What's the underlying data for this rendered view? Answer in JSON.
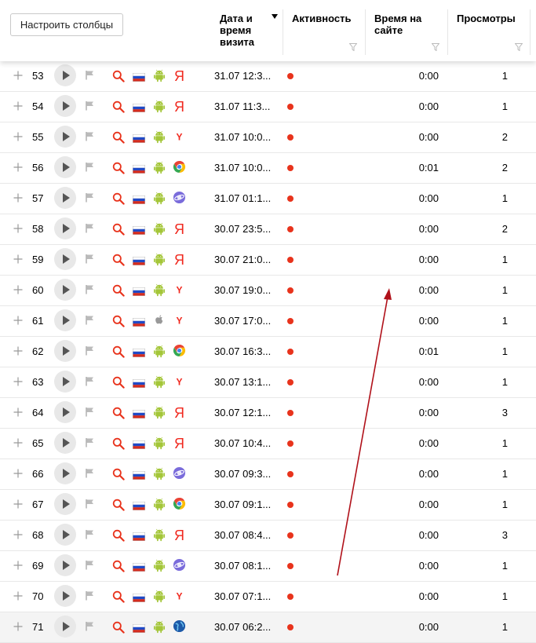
{
  "toolbar": {
    "configure_columns_label": "Настроить столбцы"
  },
  "columns": {
    "date_line1": "Дата и",
    "date_line2": "время",
    "date_line3": "визита",
    "activity": "Активность",
    "time_line1": "Время на",
    "time_line2": "сайте",
    "views": "Просмотры"
  },
  "colors": {
    "activity_dot": "#e8331c",
    "arrow": "#b0111a"
  },
  "rows": [
    {
      "num": "53",
      "os": "android",
      "browser": "yandex",
      "date": "31.07 12:3...",
      "time": "0:00",
      "views": "1"
    },
    {
      "num": "54",
      "os": "android",
      "browser": "yandex",
      "date": "31.07 11:3...",
      "time": "0:00",
      "views": "1"
    },
    {
      "num": "55",
      "os": "android",
      "browser": "yandex-round",
      "date": "31.07 10:0...",
      "time": "0:00",
      "views": "2"
    },
    {
      "num": "56",
      "os": "android",
      "browser": "chrome",
      "date": "31.07 10:0...",
      "time": "0:01",
      "views": "2"
    },
    {
      "num": "57",
      "os": "android",
      "browser": "samsung-internet",
      "date": "31.07 01:1...",
      "time": "0:00",
      "views": "1"
    },
    {
      "num": "58",
      "os": "android",
      "browser": "yandex",
      "date": "30.07 23:5...",
      "time": "0:00",
      "views": "2"
    },
    {
      "num": "59",
      "os": "android",
      "browser": "yandex",
      "date": "30.07 21:0...",
      "time": "0:00",
      "views": "1"
    },
    {
      "num": "60",
      "os": "android",
      "browser": "yandex-round",
      "date": "30.07 19:0...",
      "time": "0:00",
      "views": "1"
    },
    {
      "num": "61",
      "os": "apple",
      "browser": "yandex-round",
      "date": "30.07 17:0...",
      "time": "0:00",
      "views": "1"
    },
    {
      "num": "62",
      "os": "android",
      "browser": "chrome",
      "date": "30.07 16:3...",
      "time": "0:01",
      "views": "1"
    },
    {
      "num": "63",
      "os": "android",
      "browser": "yandex-round",
      "date": "30.07 13:1...",
      "time": "0:00",
      "views": "1"
    },
    {
      "num": "64",
      "os": "android",
      "browser": "yandex",
      "date": "30.07 12:1...",
      "time": "0:00",
      "views": "3"
    },
    {
      "num": "65",
      "os": "android",
      "browser": "yandex",
      "date": "30.07 10:4...",
      "time": "0:00",
      "views": "1"
    },
    {
      "num": "66",
      "os": "android",
      "browser": "samsung-internet",
      "date": "30.07 09:3...",
      "time": "0:00",
      "views": "1"
    },
    {
      "num": "67",
      "os": "android",
      "browser": "chrome",
      "date": "30.07 09:1...",
      "time": "0:00",
      "views": "1"
    },
    {
      "num": "68",
      "os": "android",
      "browser": "yandex",
      "date": "30.07 08:4...",
      "time": "0:00",
      "views": "3"
    },
    {
      "num": "69",
      "os": "android",
      "browser": "samsung-internet",
      "date": "30.07 08:1...",
      "time": "0:00",
      "views": "1"
    },
    {
      "num": "70",
      "os": "android",
      "browser": "yandex-round",
      "date": "30.07 07:1...",
      "time": "0:00",
      "views": "1"
    },
    {
      "num": "71",
      "os": "android",
      "browser": "globe",
      "date": "30.07 06:2...",
      "time": "0:00",
      "views": "1"
    }
  ]
}
